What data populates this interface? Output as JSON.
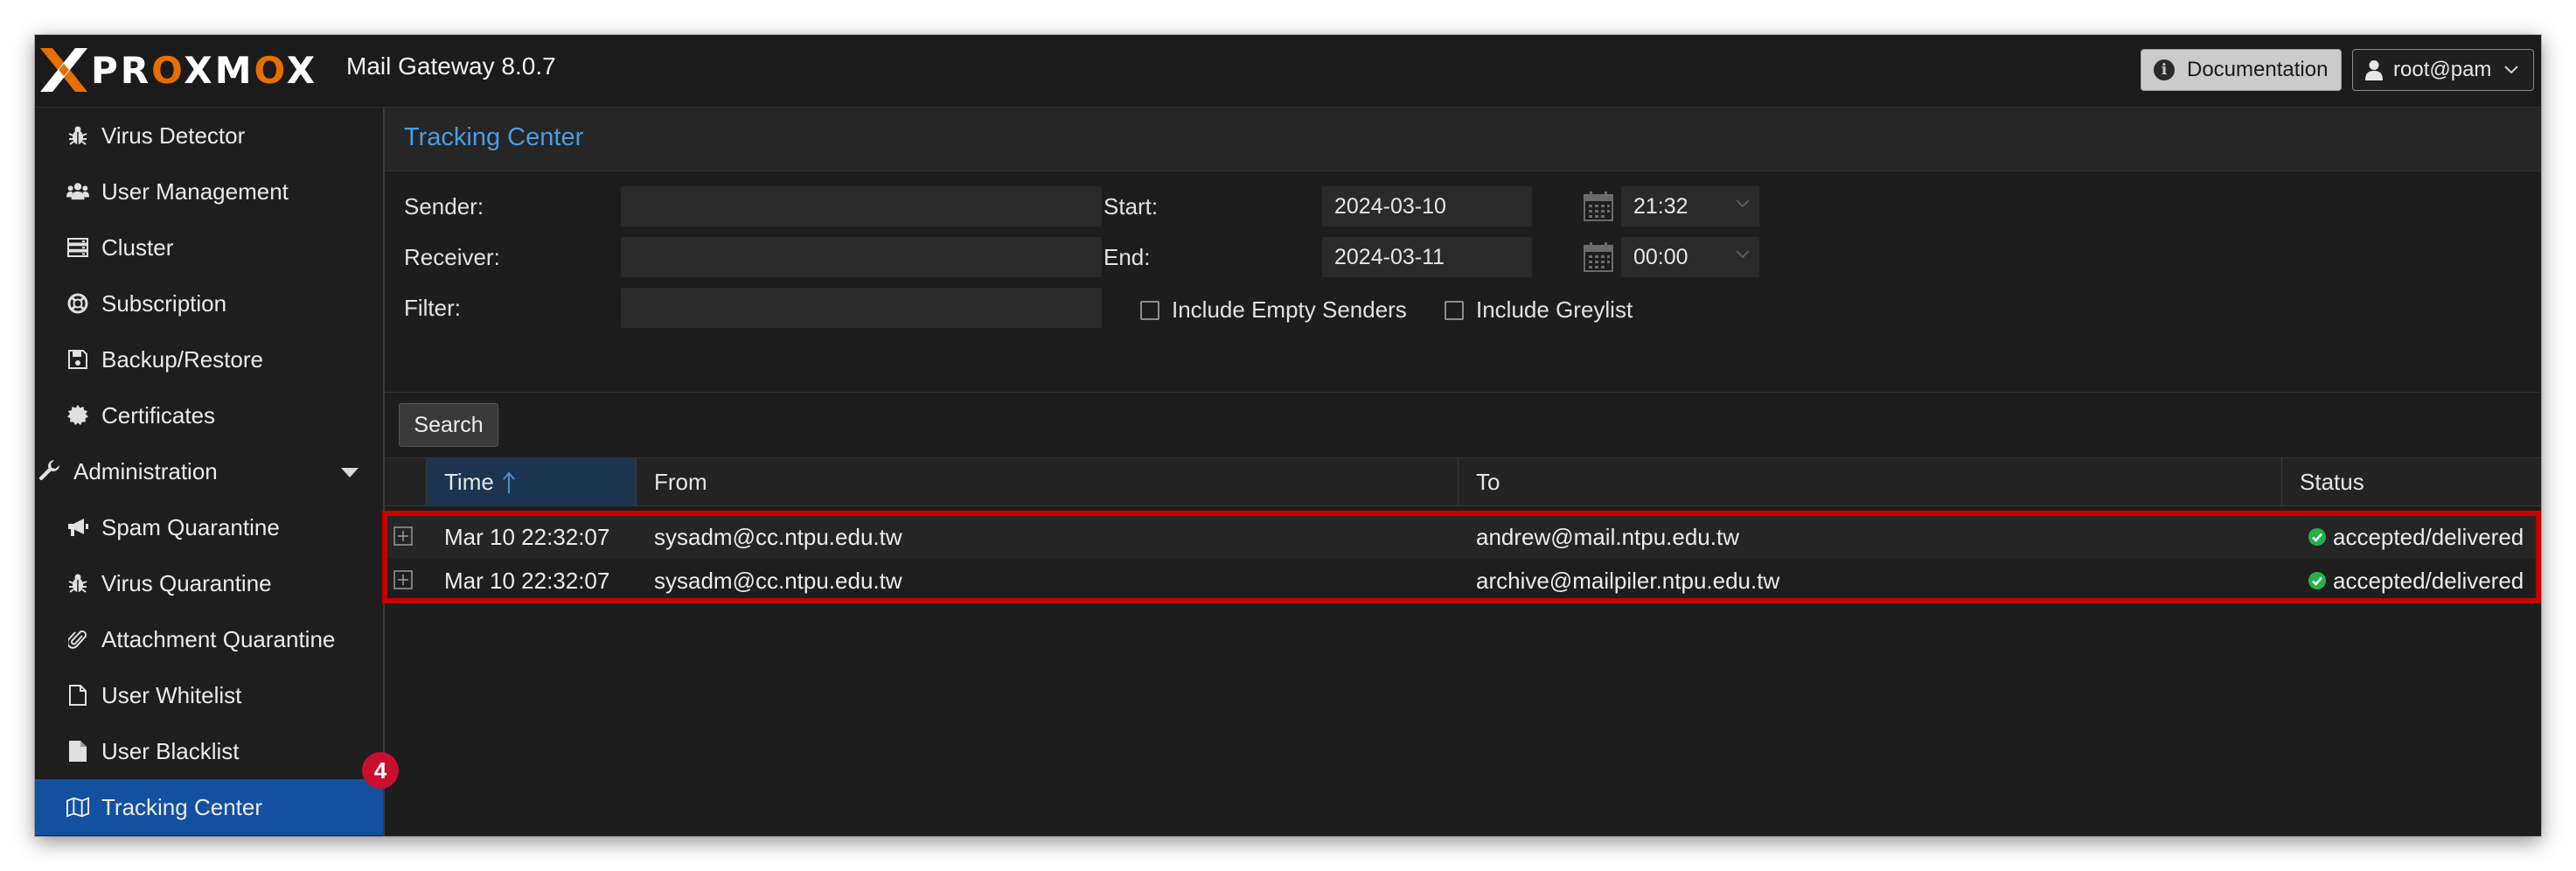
{
  "app": {
    "brand_left": "PR",
    "brand_o1": "O",
    "brand_mid": "XM",
    "brand_o2": "O",
    "brand_right": "X",
    "version": "Mail Gateway 8.0.7",
    "documentation_label": "Documentation",
    "user_label": "root@pam",
    "accent_color": "#e57000"
  },
  "sidebar": {
    "items": [
      {
        "label": "Virus Detector",
        "icon": "bug-icon"
      },
      {
        "label": "User Management",
        "icon": "users-icon"
      },
      {
        "label": "Cluster",
        "icon": "server-icon"
      },
      {
        "label": "Subscription",
        "icon": "support-icon"
      },
      {
        "label": "Backup/Restore",
        "icon": "floppy-icon"
      },
      {
        "label": "Certificates",
        "icon": "certificate-icon"
      },
      {
        "label": "Administration",
        "icon": "wrench-icon"
      },
      {
        "label": "Spam Quarantine",
        "icon": "bullhorn-icon"
      },
      {
        "label": "Virus Quarantine",
        "icon": "bug-icon"
      },
      {
        "label": "Attachment Quarantine",
        "icon": "paperclip-icon"
      },
      {
        "label": "User Whitelist",
        "icon": "file-outline-icon"
      },
      {
        "label": "User Blacklist",
        "icon": "file-icon"
      },
      {
        "label": "Tracking Center",
        "icon": "map-icon"
      }
    ],
    "active_item": "Tracking Center",
    "badge": "4",
    "badge_color": "#c8102e",
    "active_color": "#1450a0"
  },
  "panel": {
    "title": "Tracking Center"
  },
  "form": {
    "sender_label": "Sender:",
    "sender_value": "",
    "receiver_label": "Receiver:",
    "receiver_value": "",
    "filter_label": "Filter:",
    "filter_value": "",
    "start_label": "Start:",
    "start_date": "2024-03-10",
    "start_time": "21:32",
    "end_label": "End:",
    "end_date": "2024-03-11",
    "end_time": "00:00",
    "include_empty_senders": "Include Empty Senders",
    "include_greylist": "Include Greylist",
    "search_button": "Search"
  },
  "grid": {
    "columns": [
      "Time",
      "From",
      "To",
      "Status"
    ],
    "sort_column": "Time",
    "sort_direction": "ascending",
    "rows": [
      {
        "time": "Mar 10 22:32:07",
        "from": "sysadm@cc.ntpu.edu.tw",
        "to": "andrew@mail.ntpu.edu.tw",
        "status": "accepted/delivered"
      },
      {
        "time": "Mar 10 22:32:07",
        "from": "sysadm@cc.ntpu.edu.tw",
        "to": "archive@mailpiler.ntpu.edu.tw",
        "status": "accepted/delivered"
      }
    ],
    "status_ok_color": "#21b24a",
    "highlight_color": "#c40000"
  }
}
